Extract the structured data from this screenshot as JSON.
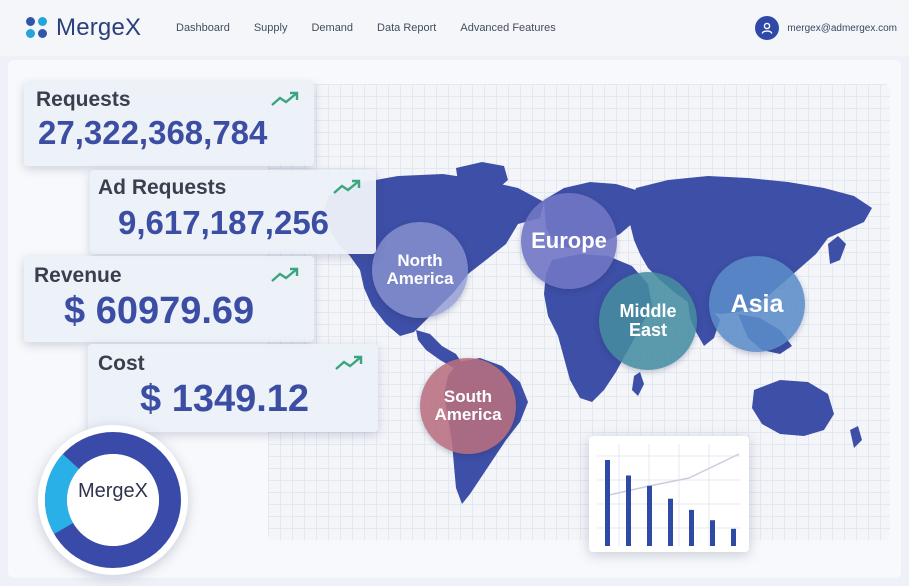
{
  "brand": {
    "name": "MergeX"
  },
  "nav": [
    {
      "label": "Dashboard"
    },
    {
      "label": "Supply"
    },
    {
      "label": "Demand"
    },
    {
      "label": "Data Report"
    },
    {
      "label": "Advanced Features"
    }
  ],
  "user": {
    "email": "mergex@admergex.com"
  },
  "stats": {
    "requests": {
      "label": "Requests",
      "value": "27,322,368,784",
      "trend_icon": "trend-up-icon"
    },
    "ad_requests": {
      "label": "Ad Requests",
      "value": "9,617,187,256",
      "trend_icon": "trend-up-icon"
    },
    "revenue": {
      "label": "Revenue",
      "value": "$ 60979.69",
      "trend_icon": "trend-up-icon"
    },
    "cost": {
      "label": "Cost",
      "value": "$ 1349.12",
      "trend_icon": "trend-up-icon"
    }
  },
  "regions": {
    "north_america": "North\nAmerica",
    "europe": "Europe",
    "middle_east": "Middle\nEast",
    "asia": "Asia",
    "south_america": "South\nAmerica"
  },
  "donut": {
    "label": "MergeX"
  },
  "mini_chart": {
    "bars": [
      1.0,
      0.82,
      0.7,
      0.55,
      0.42,
      0.3,
      0.2
    ]
  },
  "colors": {
    "brand_blue": "#3b4ea3",
    "map_blue": "#3d4fa6",
    "trend_green": "#3aa57e",
    "donut_dark": "#3a4aa8",
    "donut_light": "#29b0e6"
  }
}
